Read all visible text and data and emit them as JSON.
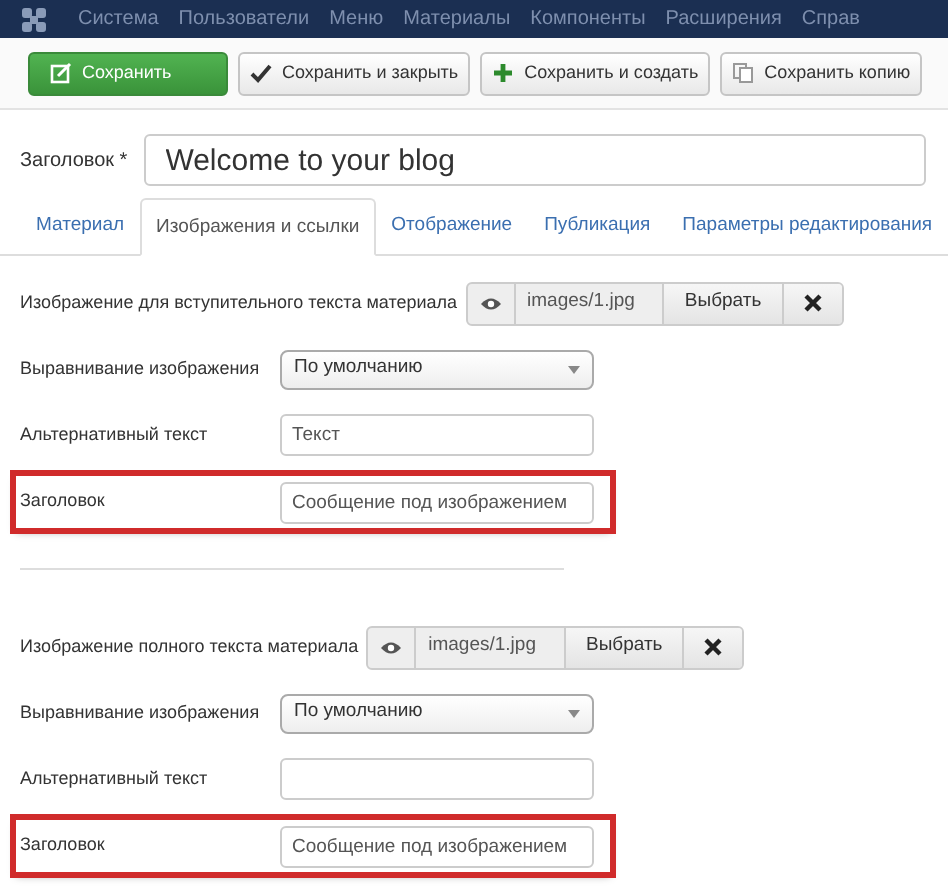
{
  "navbar": {
    "menu": [
      "Система",
      "Пользователи",
      "Меню",
      "Материалы",
      "Компоненты",
      "Расширения",
      "Справ"
    ]
  },
  "toolbar": {
    "buttons": [
      {
        "label": "Сохранить",
        "kind": "save"
      },
      {
        "label": "Сохранить и закрыть",
        "kind": "save-close"
      },
      {
        "label": "Сохранить и создать",
        "kind": "save-new"
      },
      {
        "label": "Сохранить копию",
        "kind": "save-copy"
      }
    ]
  },
  "title_field": {
    "label": "Заголовок *",
    "value": "Welcome to your blog"
  },
  "tabs": [
    {
      "label": "Материал",
      "selected": false
    },
    {
      "label": "Изображения и ссылки",
      "selected": true
    },
    {
      "label": "Отображение",
      "selected": false
    },
    {
      "label": "Публикация",
      "selected": false
    },
    {
      "label": "Параметры редактирования",
      "selected": false
    }
  ],
  "sections": [
    {
      "fields": [
        {
          "kind": "media",
          "label": "Изображение для вступительного текста материала",
          "value": "images/1.jpg",
          "button": "Выбрать",
          "highlighted": false
        },
        {
          "kind": "select",
          "label": "Выравнивание изображения",
          "value": "По умолчанию",
          "highlighted": false
        },
        {
          "kind": "text",
          "label": "Альтернативный текст",
          "value": "Текст",
          "highlighted": false
        },
        {
          "kind": "text",
          "label": "Заголовок",
          "value": "Сообщение под изображением",
          "highlighted": true
        }
      ]
    },
    {
      "fields": [
        {
          "kind": "media",
          "label": "Изображение полного текста материала",
          "value": "images/1.jpg",
          "button": "Выбрать",
          "highlighted": false
        },
        {
          "kind": "select",
          "label": "Выравнивание изображения",
          "value": "По умолчанию",
          "highlighted": false
        },
        {
          "kind": "text",
          "label": "Альтернативный текст",
          "highlighted": false
        },
        {
          "kind": "text",
          "label": "Заголовок",
          "value": "Сообщение под изображением",
          "highlighted": true
        }
      ]
    }
  ]
}
